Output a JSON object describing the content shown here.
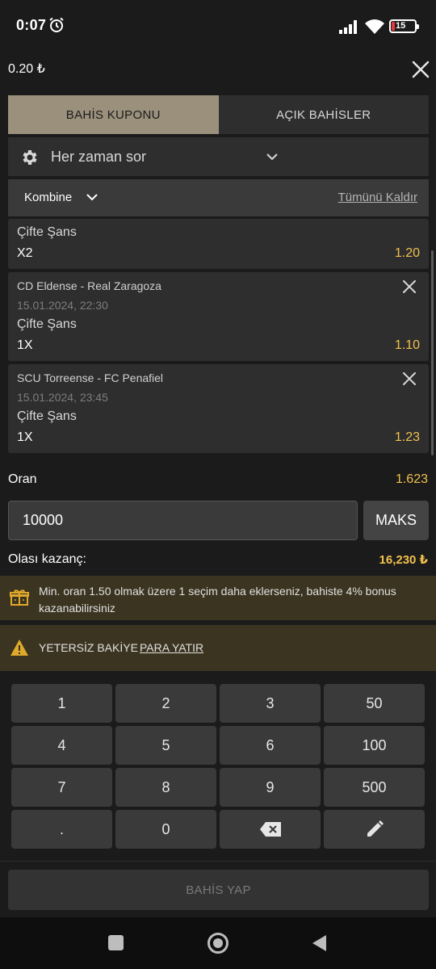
{
  "status": {
    "time": "0:07",
    "battery": "15"
  },
  "header": {
    "balance": "0.20 ₺"
  },
  "tabs": [
    {
      "label": "BAHİS KUPONU",
      "active": true
    },
    {
      "label": "AÇIK BAHİSLER",
      "active": false
    }
  ],
  "odds_change": {
    "label": "Her zaman sor"
  },
  "bet_type": {
    "label": "Kombine",
    "clear_all": "Tümünü Kaldır"
  },
  "selections": [
    {
      "match": "",
      "date": "",
      "market": "Çifte Şans",
      "pick": "X2",
      "odds": "1.20"
    },
    {
      "match": "CD Eldense - Real Zaragoza",
      "date": "15.01.2024, 22:30",
      "market": "Çifte Şans",
      "pick": "1X",
      "odds": "1.10"
    },
    {
      "match": "SCU Torreense - FC Penafiel",
      "date": "15.01.2024, 23:45",
      "market": "Çifte Şans",
      "pick": "1X",
      "odds": "1.23"
    }
  ],
  "summary": {
    "odds_label": "Oran",
    "odds_value": "1.623",
    "stake_value": "10000",
    "max_label": "MAKS",
    "win_label": "Olası kazanç:",
    "win_value": "16,230 ₺"
  },
  "bonus_banner": {
    "text": "Min. oran 1.50 olmak üzere 1 seçim daha eklerseniz, bahiste 4% bonus kazanabilirsiniz"
  },
  "warning": {
    "text": "YETERSİZ BAKİYE",
    "link": "PARA YATIR"
  },
  "keypad": {
    "keys": [
      "1",
      "2",
      "3",
      "50",
      "4",
      "5",
      "6",
      "100",
      "7",
      "8",
      "9",
      "500",
      ".",
      "0"
    ]
  },
  "place_bet": {
    "label": "BAHİS YAP"
  },
  "colors": {
    "accent": "#9a907b",
    "odds": "#f2c14e",
    "banner": "#3b3420",
    "panel": "#2e2e2e"
  }
}
